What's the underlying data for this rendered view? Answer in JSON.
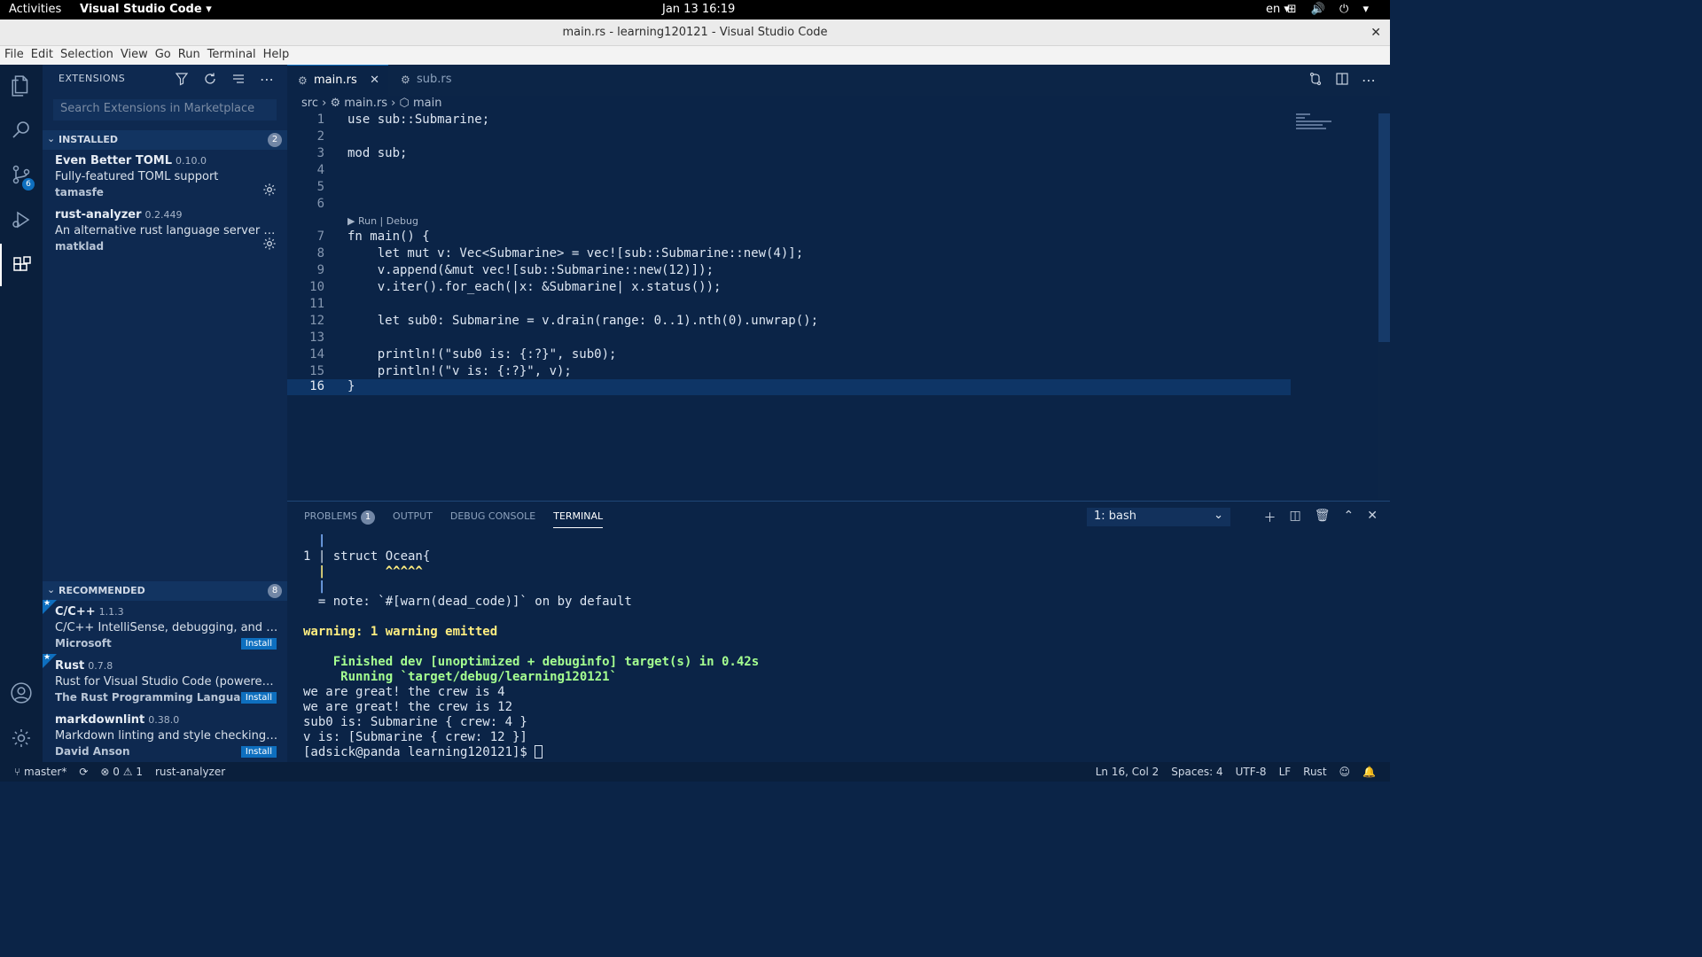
{
  "topbar": {
    "activities": "Activities",
    "app": "Visual Studio Code ▾",
    "clock": "Jan 13  16:19",
    "lang": "en ▾",
    "tray": "⊞ 🔊 ⏻ ▾"
  },
  "window": {
    "title": "main.rs - learning120121 - Visual Studio Code",
    "close": "✕"
  },
  "menu": [
    "File",
    "Edit",
    "Selection",
    "View",
    "Go",
    "Run",
    "Terminal",
    "Help"
  ],
  "activity": {
    "scm_badge": "6"
  },
  "sidebar": {
    "title": "EXTENSIONS",
    "search_placeholder": "Search Extensions in Marketplace",
    "installed": {
      "header": "INSTALLED",
      "count": "2",
      "items": [
        {
          "name": "Even Better TOML",
          "version": "0.10.0",
          "desc": "Fully-featured TOML support",
          "publisher": "tamasfe"
        },
        {
          "name": "rust-analyzer",
          "version": "0.2.449",
          "desc": "An alternative rust language server to the Rust RLS",
          "publisher": "matklad"
        }
      ]
    },
    "recommended": {
      "header": "RECOMMENDED",
      "count": "8",
      "items": [
        {
          "name": "C/C++",
          "version": "1.1.3",
          "desc": "C/C++ IntelliSense, debugging, and code browsing.",
          "publisher": "Microsoft",
          "action": "Install"
        },
        {
          "name": "Rust",
          "version": "0.7.8",
          "desc": "Rust for Visual Studio Code (powered by Rust Language Server)",
          "publisher": "The Rust Programming Language",
          "action": "Install"
        },
        {
          "name": "markdownlint",
          "version": "0.38.0",
          "desc": "Markdown linting and style checking for Visual Studio Code",
          "publisher": "David Anson",
          "action": "Install"
        }
      ]
    }
  },
  "tabs": [
    {
      "label": "main.rs",
      "icon": "rs",
      "close": "✕"
    },
    {
      "label": "sub.rs",
      "icon": "rs"
    }
  ],
  "breadcrumb": {
    "folder": "src",
    "file": "main.rs",
    "symbol": "main"
  },
  "codelens": "▶ Run | Debug",
  "code_lines": [
    "use sub::Submarine;",
    "",
    "mod sub;",
    "",
    "",
    "",
    "fn main() {",
    "    let mut v: Vec<Submarine> = vec![sub::Submarine::new(4)];",
    "    v.append(&mut vec![sub::Submarine::new(12)]);",
    "    v.iter().for_each(|x: &Submarine| x.status());",
    "",
    "    let sub0: Submarine = v.drain(range: 0..1).nth(0).unwrap();",
    "",
    "    println!(\"sub0 is: {:?}\", sub0);",
    "    println!(\"v is: {:?}\", v);",
    "}"
  ],
  "panel": {
    "tabs": [
      {
        "label": "PROBLEMS",
        "badge": "1"
      },
      {
        "label": "OUTPUT"
      },
      {
        "label": "DEBUG CONSOLE"
      },
      {
        "label": "TERMINAL"
      }
    ],
    "shell": "1: bash",
    "terminal": [
      "  |",
      "1 | struct Ocean{",
      "  |        ^^^^^",
      "  |",
      "  = note: `#[warn(dead_code)]` on by default",
      "",
      "warning: 1 warning emitted",
      "",
      "    Finished dev [unoptimized + debuginfo] target(s) in 0.42s",
      "     Running `target/debug/learning120121`",
      "we are great! the crew is 4",
      "we are great! the crew is 12",
      "sub0 is: Submarine { crew: 4 }",
      "v is: [Submarine { crew: 12 }]",
      "[adsick@panda learning120121]$ "
    ]
  },
  "status": {
    "branch": "master*",
    "errors": "⊗ 0",
    "warnings": "⚠ 1",
    "lsp": "rust-analyzer",
    "position": "Ln 16, Col 2",
    "spaces": "Spaces: 4",
    "encoding": "UTF-8",
    "eol": "LF",
    "language": "Rust"
  }
}
